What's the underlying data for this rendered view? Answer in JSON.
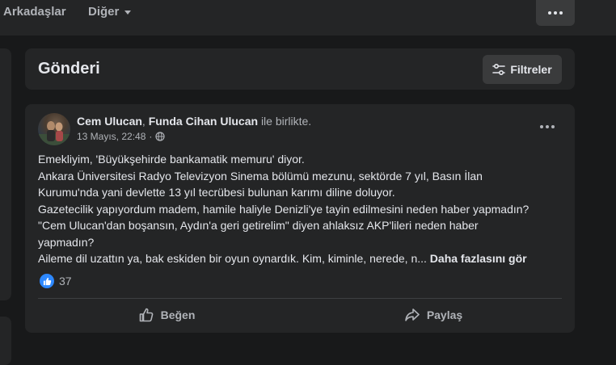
{
  "topnav": {
    "friends_label": "Arkadaşlar",
    "more_label": "Diğer"
  },
  "section": {
    "title": "Gönderi",
    "filters_label": "Filtreler"
  },
  "post": {
    "author_1": "Cem Ulucan",
    "separator": ", ",
    "author_2": "Funda Cihan Ulucan",
    "with_text": "ile birlikte.",
    "timestamp": "13 Mayıs, 22:48",
    "separator_dot": "·",
    "lines": [
      "Emekliyim, 'Büyükşehirde bankamatik memuru' diyor.",
      "Ankara Üniversitesi Radyo Televizyon Sinema bölümü mezunu, sektörde 7 yıl, Basın İlan",
      "Kurumu'nda yani devlette 13 yıl tecrübesi bulunan karımı diline doluyor.",
      "Gazetecilik yapıyordum madem, hamile haliyle Denizli'ye tayin edilmesini neden haber yapmadın?",
      "\"Cem Ulucan'dan boşansın, Aydın'a geri getirelim\" diyen ahlaksız AKP'lileri neden haber",
      "yapmadın?",
      "Aileme dil uzattın ya, bak eskiden bir oyun oynardık. Kim, kiminle, nerede, n... "
    ],
    "see_more": "Daha fazlasını gör",
    "reaction_count": "37",
    "like_label": "Beğen",
    "share_label": "Paylaş"
  },
  "colors": {
    "background": "#18191a",
    "card": "#242526",
    "button": "#3a3b3c",
    "primary_text": "#e4e6eb",
    "secondary_text": "#b0b3b8",
    "like_blue": "#2d88ff"
  },
  "icons": [
    "caret-down-icon",
    "more-dots-icon",
    "filter-sliders-icon",
    "globe-icon",
    "like-thumb-icon",
    "share-arrow-icon"
  ]
}
